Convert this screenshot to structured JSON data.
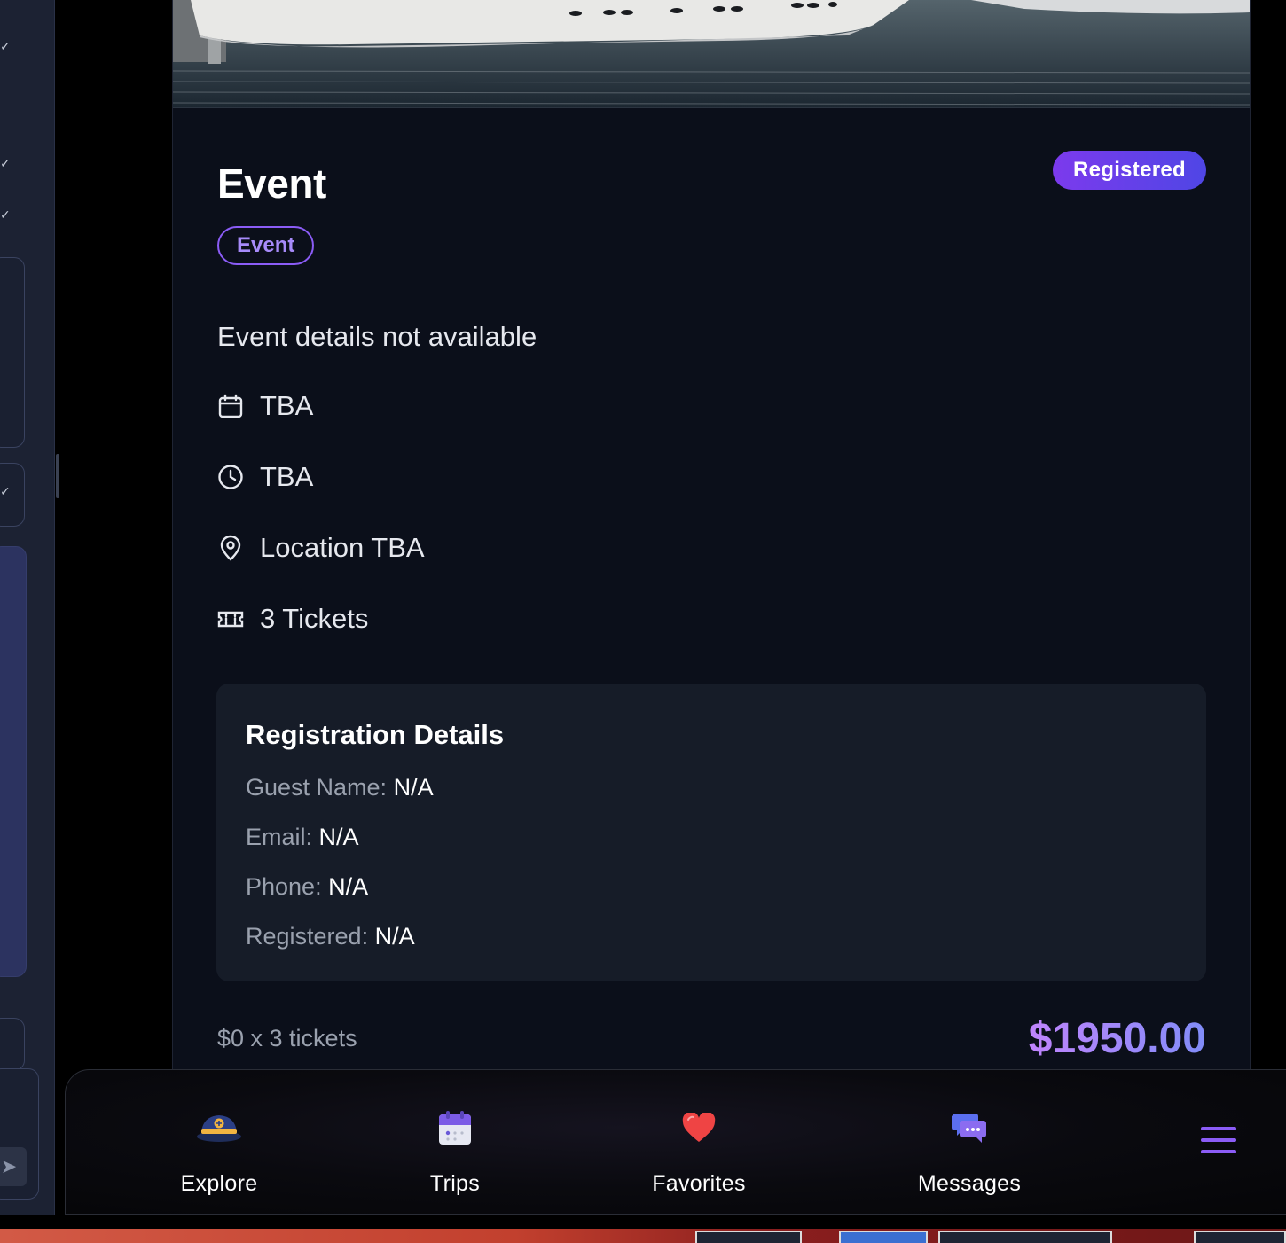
{
  "event": {
    "title": "Event",
    "status_badge": "Registered",
    "type_chip": "Event",
    "description": "Event details not available",
    "date": "TBA",
    "time": "TBA",
    "location": "Location TBA",
    "tickets": "3 Tickets"
  },
  "registration": {
    "heading": "Registration Details",
    "rows": [
      {
        "label": "Guest Name:",
        "value": "N/A"
      },
      {
        "label": "Email:",
        "value": "N/A"
      },
      {
        "label": "Phone:",
        "value": "N/A"
      },
      {
        "label": "Registered:",
        "value": "N/A"
      }
    ]
  },
  "pricing": {
    "breakdown": "$0 x 3 tickets",
    "total": "$1950.00"
  },
  "nav": {
    "items": [
      {
        "label": "Explore",
        "icon": "captain-hat-icon"
      },
      {
        "label": "Trips",
        "icon": "calendar-icon"
      },
      {
        "label": "Favorites",
        "icon": "heart-icon"
      },
      {
        "label": "Messages",
        "icon": "chat-bubbles-icon"
      }
    ],
    "menu_icon": "hamburger-menu-icon"
  },
  "colors": {
    "accent": "#8b5cf6",
    "badge_gradient_start": "#7c3aed",
    "badge_gradient_end": "#4f46e5",
    "modal_bg": "#0b0f1a",
    "card_bg": "#161c28"
  }
}
